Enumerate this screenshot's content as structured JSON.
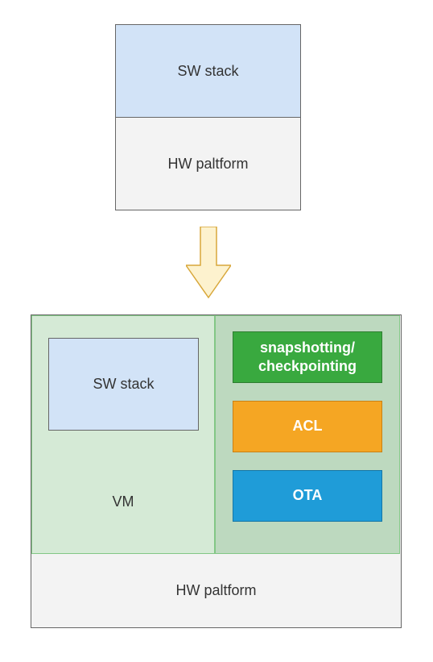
{
  "top": {
    "sw_label": "SW stack",
    "hw_label": "HW paltform"
  },
  "bottom": {
    "vm": {
      "sw_label": "SW stack",
      "vm_label": "VM"
    },
    "features": {
      "snapshot_label": "snapshotting/\ncheckpointing",
      "acl_label": "ACL",
      "ota_label": "OTA"
    },
    "hw_label": "HW paltform"
  },
  "chart_data": {
    "type": "diagram",
    "description": "Architecture diagram showing transition from simple SW/HW stack to virtualized stack with VM layer containing SW stack, plus features (snapshotting/checkpointing, ACL, OTA) on HW platform",
    "top_block": {
      "layers": [
        "SW stack",
        "HW paltform"
      ]
    },
    "arrow": "down",
    "bottom_block": {
      "hw_layer": "HW paltform",
      "vm_layer": {
        "label": "VM",
        "contains": "SW stack"
      },
      "features": [
        "snapshotting/checkpointing",
        "ACL",
        "OTA"
      ]
    }
  }
}
